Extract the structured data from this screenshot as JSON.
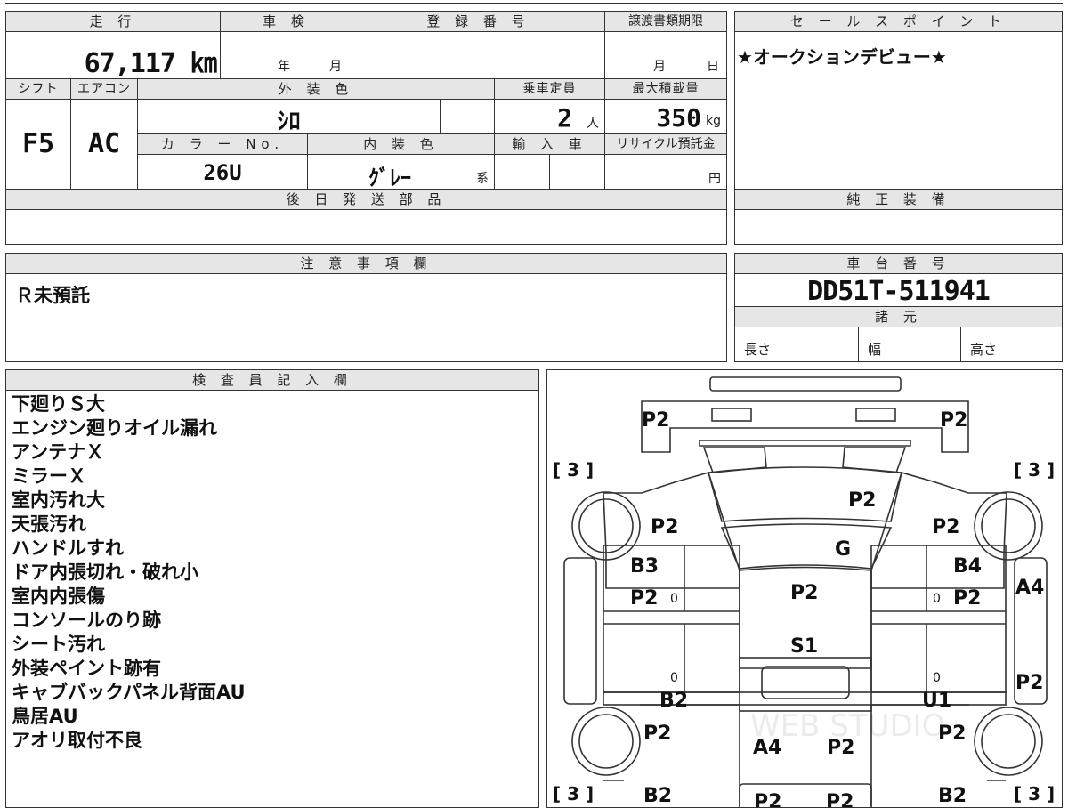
{
  "top_table": {
    "mileage_label": "走 行",
    "mileage_value": "67,117 ㎞",
    "inspection_label": "車 検",
    "inspection_year_unit": "年",
    "inspection_month_unit": "月",
    "registration_label": "登 録 番 号",
    "transfer_label": "譲渡書類期限",
    "transfer_month_unit": "月",
    "transfer_day_unit": "日",
    "shift_label": "シフト",
    "shift_value": "F5",
    "ac_label": "エアコン",
    "ac_value": "AC",
    "exterior_label": "外 装 色",
    "exterior_value": "ｼﾛ",
    "capacity_label": "乗車定員",
    "capacity_value": "2",
    "capacity_unit": "人",
    "load_label": "最大積載量",
    "load_value": "350",
    "load_unit": "kg",
    "color_no_label": "カ ラ ー No.",
    "color_no_value": "26U",
    "interior_label": "内 装 色",
    "interior_value": "ｸﾞﾚｰ",
    "interior_suffix": "系",
    "import_label": "輸 入 車",
    "recycle_label": "リサイクル預託金",
    "recycle_unit": "円",
    "later_parts_label": "後 日 発 送 部 品"
  },
  "sales_point": {
    "label": "セ ー ル ス ポ イ ン ト",
    "text": "★オークションデビュー★",
    "genuine_label": "純 正 装 備"
  },
  "notes": {
    "label": "注 意 事 項 欄",
    "text": "Ｒ未預託"
  },
  "chassis": {
    "label": "車 台 番 号",
    "value": "DD51T-511941",
    "specs_label": "諸 元",
    "length_label": "長さ",
    "width_label": "幅",
    "height_label": "高さ"
  },
  "inspector": {
    "label": "検 査 員 記 入 欄",
    "lines": [
      "下廻りＳ大",
      "エンジン廻りオイル漏れ",
      "アンテナＸ",
      "ミラーＸ",
      "室内汚れ大",
      "天張汚れ",
      "ハンドルすれ",
      "ドア内張切れ・破れ小",
      "室内内張傷",
      "コンソールのり跡",
      "シート汚れ",
      "外装ペイント跡有",
      "キャブバックパネル背面AU",
      "鳥居AU",
      "アオリ取付不良"
    ]
  },
  "diagram": {
    "marks": {
      "bumper_l": "P2",
      "bumper_r": "P2",
      "corner_fl": "[ 3 ]",
      "corner_fr": "[ 3 ]",
      "hood": "P2",
      "fender_l": "P2",
      "fender_r": "P2",
      "windshield": "G",
      "door_l_a": "B3",
      "door_l_b": "P2",
      "door_l_zero": "0",
      "door_r_a": "B4",
      "door_r_b": "P2",
      "door_r_zero": "0",
      "roof": "P2",
      "rear_panel": "S1",
      "side_r_top": "A4",
      "side_r_mid": "P2",
      "low_l_zero": "0",
      "low_r_zero": "0",
      "sill_l": "B2",
      "sill_r": "U1",
      "bed_l": "P2",
      "bed_r": "P2",
      "bed_a": "A4",
      "bed_b": "P2",
      "corner_rl": "[ 3 ]",
      "corner_rr": "[ 3 ]",
      "rear_l": "B2",
      "rear_r": "B2",
      "tail_a": "P2",
      "tail_b": "P2"
    },
    "watermark": "WEB STUDIO"
  }
}
